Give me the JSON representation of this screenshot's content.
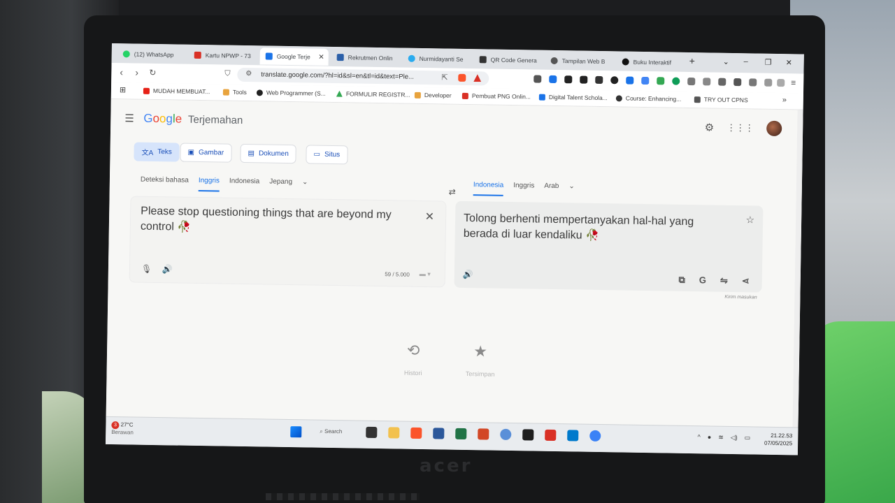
{
  "browser": {
    "tabs": [
      {
        "label": "(12) WhatsApp",
        "color": "#25d366"
      },
      {
        "label": "Kartu NPWP - 73",
        "color": "#d93025"
      },
      {
        "label": "Google Terje",
        "color": "#1a73e8",
        "active": true
      },
      {
        "label": "Rekrutmen Onlin",
        "color": "#2b5fa8"
      },
      {
        "label": "Nurmidayanti Se",
        "color": "#2aabee"
      },
      {
        "label": "QR Code Genera",
        "color": "#333333"
      },
      {
        "label": "Tampilan Web B",
        "color": "#555555"
      },
      {
        "label": "Buku Interaktif",
        "color": "#111111"
      }
    ],
    "new_tab": "+",
    "address": "translate.google.com/?hl=id&sl=en&tl=id&text=Ple...",
    "bookmarks": [
      {
        "label": "MUDAH MEMBUAT...",
        "color": "#e62117"
      },
      {
        "label": "Tools",
        "color": "#e8a33d"
      },
      {
        "label": "Web Programmer (S...",
        "color": "#222222"
      },
      {
        "label": "FORMULIR REGISTR...",
        "color": "#34a853"
      },
      {
        "label": "Developer",
        "color": "#e8a33d"
      },
      {
        "label": "Pembuat PNG Onlin...",
        "color": "#d93025"
      },
      {
        "label": "Digital Talent Schola...",
        "color": "#1a73e8"
      },
      {
        "label": "Course: Enhancing...",
        "color": "#333333"
      },
      {
        "label": "TRY OUT CPNS",
        "color": "#555555"
      }
    ],
    "bookmarks_more": "»"
  },
  "translate": {
    "brand": {
      "g1": "G",
      "g2": "o",
      "g3": "o",
      "g1b": "g",
      "g4": "l",
      "g2b": "e",
      "service": "Terjemahan"
    },
    "modes": [
      "Teks",
      "Gambar",
      "Dokumen",
      "Situs"
    ],
    "source_langs": [
      "Deteksi bahasa",
      "Inggris",
      "Indonesia",
      "Jepang"
    ],
    "target_langs": [
      "Indonesia",
      "Inggris",
      "Arab"
    ],
    "source_text": "Please stop questioning things that are beyond my control 🥀",
    "target_text": "Tolong berhenti mempertanyakan hal-hal yang berada di luar kendaliku 🥀",
    "char_count": "59 / 5.000",
    "feedback": "Kirim masukan",
    "history_label": "Histori",
    "saved_label": "Tersimpan"
  },
  "taskbar": {
    "weather_badge": "3",
    "temperature": "27°C",
    "condition": "Berawan",
    "search": "Search",
    "time": "21.22.53",
    "date": "07/05/2025"
  }
}
